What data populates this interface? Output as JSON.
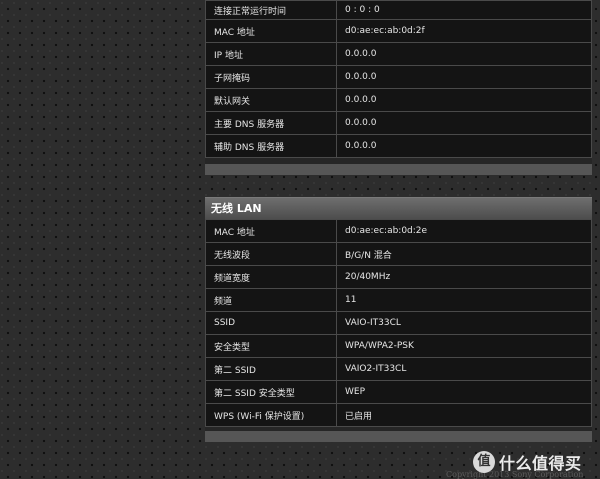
{
  "wan": {
    "rows": [
      {
        "label": "连接正常运行时间",
        "value": "0 : 0 : 0"
      },
      {
        "label": "MAC 地址",
        "value": "d0:ae:ec:ab:0d:2f"
      },
      {
        "label": "IP 地址",
        "value": "0.0.0.0"
      },
      {
        "label": "子网掩码",
        "value": "0.0.0.0"
      },
      {
        "label": "默认网关",
        "value": "0.0.0.0"
      },
      {
        "label": "主要 DNS 服务器",
        "value": "0.0.0.0"
      },
      {
        "label": "辅助 DNS 服务器",
        "value": "0.0.0.0"
      }
    ]
  },
  "wlan": {
    "title": "无线 LAN",
    "rows": [
      {
        "label": "MAC 地址",
        "value": "d0:ae:ec:ab:0d:2e"
      },
      {
        "label": "无线波段",
        "value": "B/G/N 混合"
      },
      {
        "label": "频道宽度",
        "value": "20/40MHz"
      },
      {
        "label": "频道",
        "value": "11"
      },
      {
        "label": "SSID",
        "value": "VAIO-IT33CL"
      },
      {
        "label": "安全类型",
        "value": "WPA/WPA2-PSK"
      },
      {
        "label": "第二 SSID",
        "value": "VAIO2-IT33CL"
      },
      {
        "label": "第二 SSID 安全类型",
        "value": "WEP"
      },
      {
        "label": "WPS (Wi-Fi 保护设置)",
        "value": "已启用"
      }
    ]
  },
  "footer": {
    "copyright": "Copyright 2013 Sony Corporation"
  },
  "watermark": {
    "logo_glyph": "值",
    "text": "什么值得买"
  }
}
